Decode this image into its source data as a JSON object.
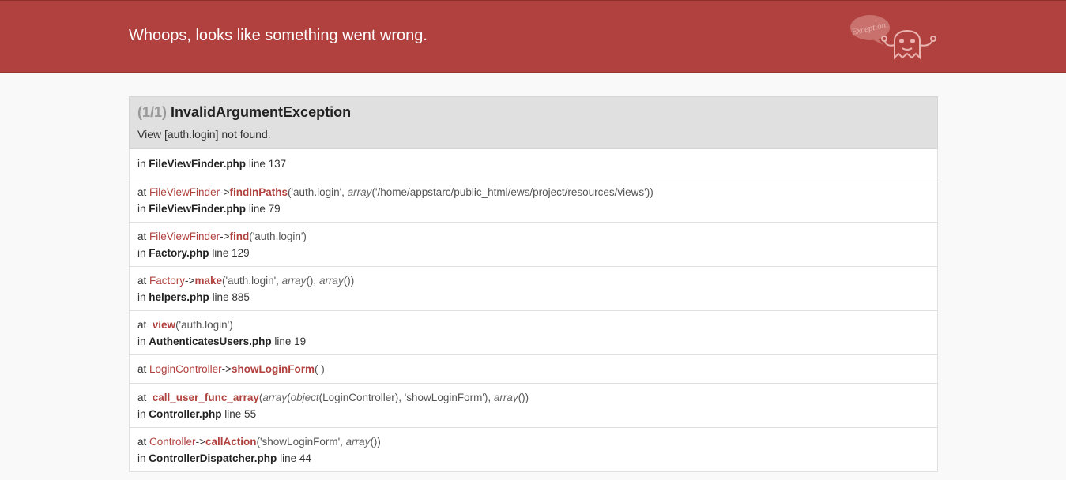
{
  "header": {
    "title": "Whoops, looks like something went wrong.",
    "logo_text": "Exception!"
  },
  "exception": {
    "count": "(1/1)",
    "class": "InvalidArgumentException",
    "message": "View [auth.login] not found."
  },
  "location": {
    "in_label": "in",
    "file": "FileViewFinder.php",
    "line": "line 137"
  },
  "frames": [
    {
      "at": "at",
      "class": "FileViewFinder",
      "arrow": "->",
      "function": "findInPaths",
      "args_open": "('auth.login', ",
      "args_italic": "array",
      "args_close": "('/home/appstarc/public_html/ews/project/resources/views'))",
      "in": "in",
      "file": "FileViewFinder.php",
      "line": "line 79"
    },
    {
      "at": "at",
      "class": "FileViewFinder",
      "arrow": "->",
      "function": "find",
      "args": "('auth.login')",
      "in": "in",
      "file": "Factory.php",
      "line": "line 129"
    },
    {
      "at": "at",
      "class": "Factory",
      "arrow": "->",
      "function": "make",
      "args_a": "('auth.login', ",
      "args_italic1": "array",
      "args_b": "(), ",
      "args_italic2": "array",
      "args_c": "())",
      "in": "in",
      "file": "helpers.php",
      "line": "line 885"
    },
    {
      "at": "at",
      "function": "view",
      "args": "('auth.login')",
      "in": "in",
      "file": "AuthenticatesUsers.php",
      "line": "line 19"
    },
    {
      "at": "at",
      "class": "LoginController",
      "arrow": "->",
      "function": "showLoginForm",
      "args": "( )"
    },
    {
      "at": "at",
      "function": "call_user_func_array",
      "args_a": "(",
      "args_italic1": "array",
      "args_b": "(",
      "args_italic2": "object",
      "args_c": "(LoginController), 'showLoginForm'), ",
      "args_italic3": "array",
      "args_d": "())",
      "in": "in",
      "file": "Controller.php",
      "line": "line 55"
    },
    {
      "at": "at",
      "class": "Controller",
      "arrow": "->",
      "function": "callAction",
      "args_a": "('showLoginForm', ",
      "args_italic1": "array",
      "args_b": "())",
      "in": "in",
      "file": "ControllerDispatcher.php",
      "line": "line 44"
    }
  ],
  "colors": {
    "header_bg": "#b0413e",
    "accent": "#b0413e",
    "page_bg": "#f9f9f9",
    "exception_header_bg": "#e0e0e0"
  }
}
